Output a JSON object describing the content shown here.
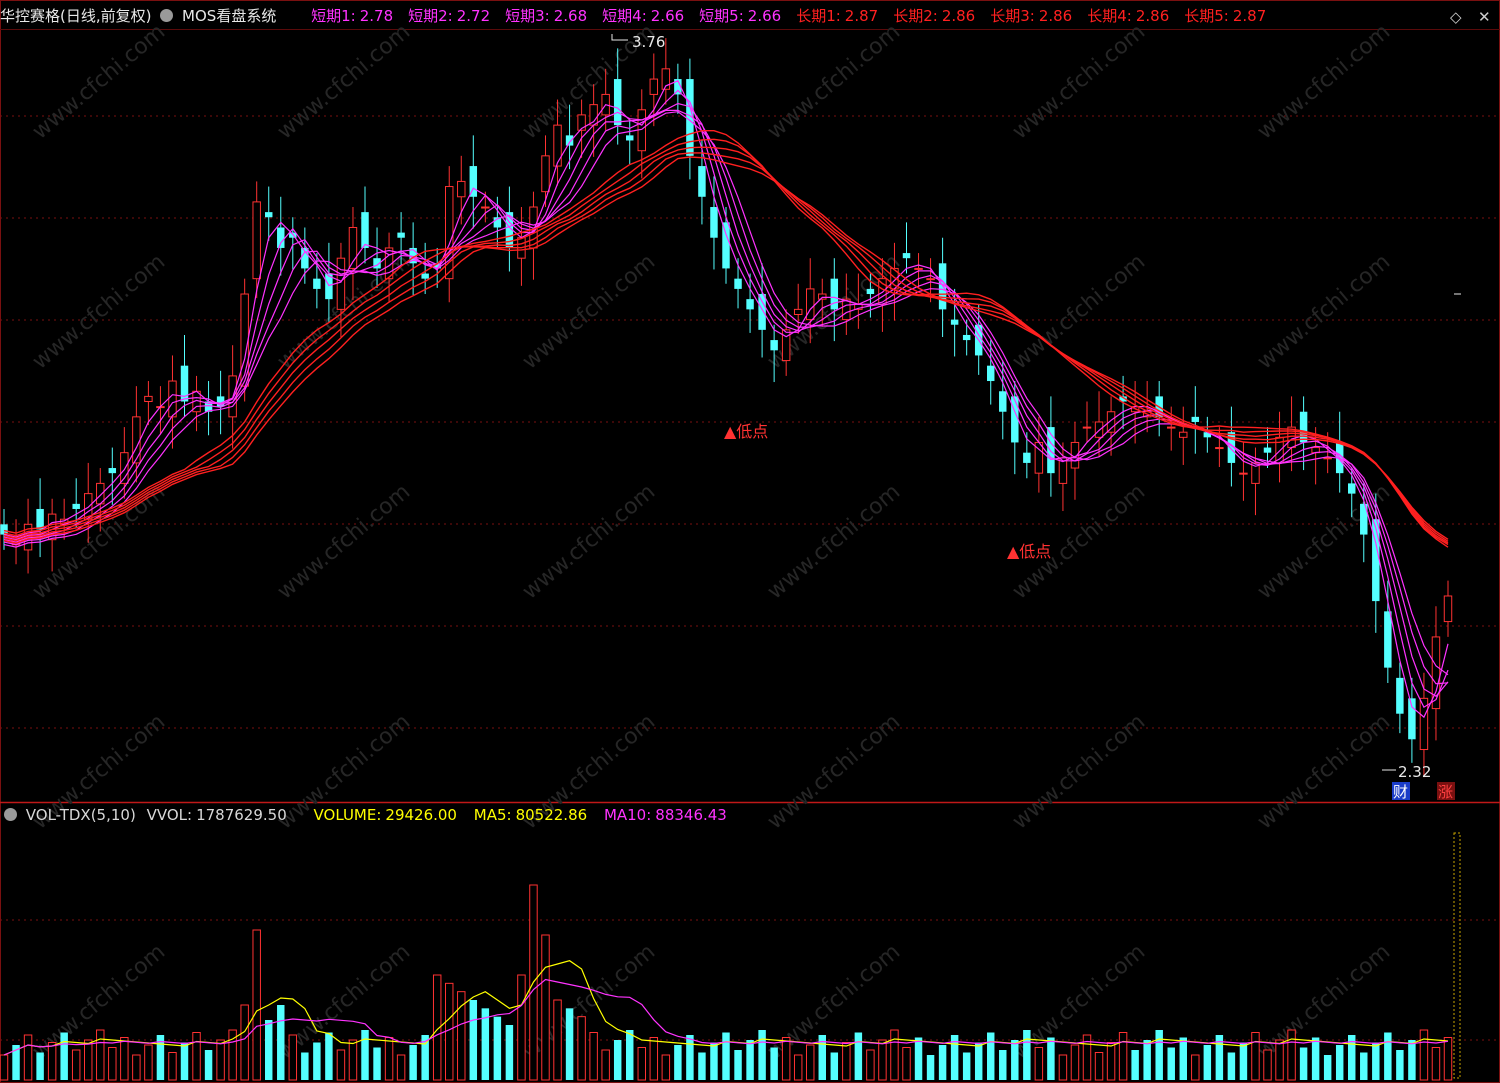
{
  "main_panel": {
    "stock_title": "华控赛格(日线,前复权)",
    "indicator_name": "MOS看盘系统",
    "short_terms": [
      {
        "label": "短期1:",
        "value": "2.78"
      },
      {
        "label": "短期2:",
        "value": "2.72"
      },
      {
        "label": "短期3:",
        "value": "2.68"
      },
      {
        "label": "短期4:",
        "value": "2.66"
      },
      {
        "label": "短期5:",
        "value": "2.66"
      }
    ],
    "long_terms": [
      {
        "label": "长期1:",
        "value": "2.87"
      },
      {
        "label": "长期2:",
        "value": "2.86"
      },
      {
        "label": "长期3:",
        "value": "2.86"
      },
      {
        "label": "长期4:",
        "value": "2.86"
      },
      {
        "label": "长期5:",
        "value": "2.87"
      }
    ],
    "high_label": "3.76",
    "low_label": "2.32",
    "signal_label": "▲低点",
    "badge_cai": "财",
    "badge_zhang": "涨"
  },
  "volume_panel": {
    "indicator_name": "VOL-TDX(5,10)",
    "vvol_label": "VVOL:",
    "vvol_value": "1787629.50",
    "volume_label": "VOLUME:",
    "volume_value": "29426.00",
    "ma5_label": "MA5:",
    "ma5_value": "80522.86",
    "ma10_label": "MA10:",
    "ma10_value": "88346.43"
  },
  "watermark": "www.cfchi.com",
  "colors": {
    "up": "#ff3232",
    "down": "#54ffff",
    "short_ma": "#ff33ff",
    "long_ma": "#ff2020",
    "ma5": "#ffff00",
    "ma10": "#ff33ff",
    "grid": "#7a1010",
    "text_gray": "#d8d8d8"
  }
}
